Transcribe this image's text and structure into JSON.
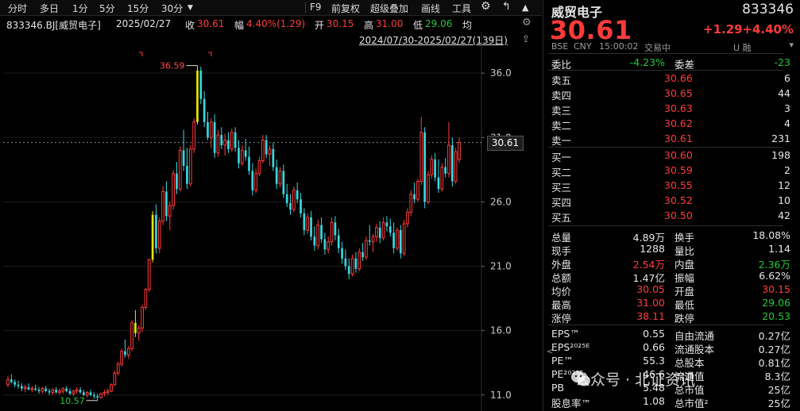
{
  "toolbar": {
    "periods": [
      "分时",
      "多日",
      "1分",
      "5分",
      "15分",
      "30分"
    ],
    "f9": "F9",
    "adjust": "前复权",
    "overlay": "超级叠加",
    "draw": "画线",
    "tools": "工具",
    "icons": [
      "gear-icon",
      "back-icon",
      "up-icon"
    ]
  },
  "infobar": {
    "code_name": "833346.BJ[威贸电子]",
    "date": "2025/02/27",
    "close_label": "收",
    "close": "30.61",
    "change_label": "幅",
    "change": "4.40%(1.29)",
    "open_label": "开",
    "open": "30.15",
    "high_label": "高",
    "high": "31.00",
    "low_label": "低",
    "low": "29.06",
    "avg_label": "均"
  },
  "range_text": "2024/07/30-2025/02/27(139日)",
  "chart_data": {
    "type": "candlestick",
    "ylim": [
      10.0,
      38.6
    ],
    "y_ticks": [
      "36.0",
      "31.0",
      "26.0",
      "21.0",
      "16.0",
      "11.0"
    ],
    "y_tick_values": [
      36.0,
      31.0,
      26.0,
      21.0,
      16.0,
      11.0
    ],
    "last_price": "30.61",
    "high_marker": "36.59",
    "low_marker": "10.57",
    "candles": [
      [
        11.8,
        12.5,
        11.6,
        12.2
      ],
      [
        12.2,
        12.6,
        11.9,
        12.0
      ],
      [
        12.0,
        12.2,
        11.6,
        11.8
      ],
      [
        11.8,
        12.1,
        11.5,
        11.7
      ],
      [
        11.7,
        11.9,
        11.3,
        11.5
      ],
      [
        11.5,
        11.8,
        11.2,
        11.6
      ],
      [
        11.6,
        11.9,
        11.4,
        11.4
      ],
      [
        11.4,
        11.7,
        11.2,
        11.5
      ],
      [
        11.5,
        11.8,
        11.3,
        11.4
      ],
      [
        11.4,
        11.6,
        11.1,
        11.3
      ],
      [
        11.3,
        11.6,
        11.1,
        11.5
      ],
      [
        11.5,
        11.7,
        11.2,
        11.3
      ],
      [
        11.3,
        11.5,
        11.0,
        11.2
      ],
      [
        11.2,
        11.5,
        11.0,
        11.4
      ],
      [
        11.4,
        11.6,
        11.1,
        11.2
      ],
      [
        11.2,
        11.5,
        11.0,
        11.3
      ],
      [
        11.3,
        11.6,
        11.1,
        11.5
      ],
      [
        11.5,
        11.7,
        11.2,
        11.3
      ],
      [
        11.3,
        11.5,
        11.0,
        11.1
      ],
      [
        11.1,
        11.4,
        10.9,
        11.3
      ],
      [
        11.3,
        11.6,
        11.1,
        11.4
      ],
      [
        11.4,
        11.6,
        11.1,
        11.2
      ],
      [
        11.2,
        11.4,
        10.9,
        11.0
      ],
      [
        11.0,
        11.3,
        10.8,
        11.2
      ],
      [
        11.2,
        11.4,
        10.9,
        11.0
      ],
      [
        11.0,
        11.2,
        10.7,
        10.9
      ],
      [
        10.9,
        11.1,
        10.57,
        10.8
      ],
      [
        10.8,
        11.2,
        10.7,
        11.1
      ],
      [
        11.1,
        11.4,
        10.9,
        11.2
      ],
      [
        11.2,
        11.5,
        11.0,
        11.3
      ],
      [
        11.3,
        11.9,
        11.2,
        11.8
      ],
      [
        11.8,
        12.9,
        11.7,
        12.7
      ],
      [
        12.7,
        13.6,
        12.5,
        13.4
      ],
      [
        13.4,
        14.6,
        13.2,
        14.4
      ],
      [
        14.4,
        15.3,
        13.9,
        14.1
      ],
      [
        14.1,
        14.8,
        13.8,
        14.6
      ],
      [
        14.6,
        16.8,
        14.4,
        16.6
      ],
      [
        16.6,
        17.6,
        15.5,
        15.8
      ],
      [
        15.8,
        16.4,
        15.2,
        16.2
      ],
      [
        16.2,
        18.0,
        15.9,
        17.8
      ],
      [
        17.8,
        19.3,
        17.6,
        19.2
      ],
      [
        19.2,
        21.6,
        19.0,
        21.5
      ],
      [
        21.5,
        25.3,
        21.3,
        25.0
      ],
      [
        25.0,
        25.8,
        22.0,
        22.4
      ],
      [
        22.4,
        24.8,
        22.0,
        24.5
      ],
      [
        24.5,
        27.2,
        24.2,
        26.8
      ],
      [
        26.8,
        27.6,
        24.5,
        24.9
      ],
      [
        24.9,
        26.0,
        23.8,
        25.7
      ],
      [
        25.7,
        28.5,
        25.4,
        28.2
      ],
      [
        28.2,
        29.1,
        26.6,
        27.0
      ],
      [
        27.0,
        30.3,
        26.8,
        30.0
      ],
      [
        30.0,
        31.6,
        28.4,
        28.8
      ],
      [
        28.8,
        30.2,
        27.0,
        27.4
      ],
      [
        27.4,
        30.4,
        27.2,
        30.1
      ],
      [
        30.1,
        32.5,
        29.8,
        32.2
      ],
      [
        32.2,
        36.59,
        32.0,
        36.2
      ],
      [
        36.2,
        36.5,
        33.6,
        34.0
      ],
      [
        34.0,
        34.6,
        31.8,
        32.2
      ],
      [
        32.2,
        33.0,
        30.8,
        31.0
      ],
      [
        31.0,
        32.5,
        30.2,
        32.2
      ],
      [
        32.2,
        32.8,
        29.4,
        29.8
      ],
      [
        29.8,
        31.6,
        29.5,
        31.2
      ],
      [
        31.2,
        31.8,
        30.1,
        30.4
      ],
      [
        30.4,
        31.3,
        29.6,
        30.8
      ],
      [
        30.8,
        31.4,
        29.8,
        30.1
      ],
      [
        30.1,
        31.7,
        29.9,
        31.4
      ],
      [
        31.4,
        31.8,
        29.9,
        30.2
      ],
      [
        30.2,
        30.8,
        28.6,
        29.0
      ],
      [
        29.0,
        30.4,
        28.8,
        30.0
      ],
      [
        30.0,
        30.9,
        29.2,
        29.5
      ],
      [
        29.5,
        30.3,
        28.1,
        28.4
      ],
      [
        28.4,
        29.0,
        26.5,
        26.9
      ],
      [
        26.9,
        28.6,
        26.7,
        28.2
      ],
      [
        28.2,
        29.5,
        28.0,
        29.2
      ],
      [
        29.2,
        31.2,
        29.0,
        30.8
      ],
      [
        30.8,
        31.2,
        29.4,
        29.7
      ],
      [
        29.7,
        30.4,
        28.8,
        30.1
      ],
      [
        30.1,
        30.6,
        28.4,
        28.7
      ],
      [
        28.7,
        29.3,
        27.0,
        27.4
      ],
      [
        27.4,
        28.7,
        27.1,
        28.4
      ],
      [
        28.4,
        28.9,
        26.3,
        26.6
      ],
      [
        26.6,
        27.4,
        25.6,
        25.9
      ],
      [
        25.9,
        26.6,
        25.0,
        25.4
      ],
      [
        25.4,
        27.2,
        25.2,
        26.9
      ],
      [
        26.9,
        27.5,
        25.9,
        26.2
      ],
      [
        26.2,
        26.7,
        24.8,
        25.1
      ],
      [
        25.1,
        25.5,
        23.4,
        23.8
      ],
      [
        23.8,
        25.1,
        23.5,
        24.8
      ],
      [
        24.8,
        25.3,
        23.0,
        23.3
      ],
      [
        23.3,
        24.1,
        22.2,
        22.6
      ],
      [
        22.6,
        24.6,
        22.3,
        24.2
      ],
      [
        24.2,
        24.8,
        22.8,
        23.1
      ],
      [
        23.1,
        23.6,
        21.9,
        22.3
      ],
      [
        22.3,
        23.3,
        22.0,
        22.9
      ],
      [
        22.9,
        24.8,
        22.6,
        24.4
      ],
      [
        24.4,
        24.9,
        23.0,
        23.4
      ],
      [
        23.4,
        23.9,
        22.0,
        22.4
      ],
      [
        22.4,
        22.9,
        21.2,
        21.6
      ],
      [
        21.6,
        22.3,
        20.7,
        21.0
      ],
      [
        21.0,
        21.6,
        20.0,
        20.4
      ],
      [
        20.4,
        21.9,
        20.2,
        21.6
      ],
      [
        21.6,
        22.1,
        20.5,
        20.8
      ],
      [
        20.8,
        22.4,
        20.6,
        22.1
      ],
      [
        22.1,
        22.8,
        21.4,
        21.7
      ],
      [
        21.7,
        23.3,
        21.5,
        23.0
      ],
      [
        23.0,
        24.2,
        22.6,
        22.9
      ],
      [
        22.9,
        23.5,
        22.1,
        23.3
      ],
      [
        23.3,
        24.3,
        22.9,
        24.0
      ],
      [
        24.0,
        24.5,
        22.8,
        23.2
      ],
      [
        23.2,
        24.8,
        23.0,
        24.4
      ],
      [
        24.4,
        24.9,
        23.7,
        24.1
      ],
      [
        24.1,
        24.7,
        23.3,
        23.6
      ],
      [
        23.6,
        24.4,
        22.0,
        22.4
      ],
      [
        22.4,
        24.0,
        22.2,
        23.8
      ],
      [
        23.8,
        24.2,
        21.6,
        22.0
      ],
      [
        22.0,
        24.6,
        21.8,
        24.3
      ],
      [
        24.3,
        25.5,
        24.0,
        25.2
      ],
      [
        25.2,
        26.9,
        24.9,
        26.6
      ],
      [
        26.6,
        27.5,
        25.9,
        26.2
      ],
      [
        26.2,
        27.8,
        26.0,
        27.6
      ],
      [
        27.6,
        32.6,
        27.3,
        31.4
      ],
      [
        31.4,
        31.8,
        25.5,
        26.0
      ],
      [
        26.0,
        28.4,
        25.8,
        28.1
      ],
      [
        28.1,
        29.6,
        27.8,
        29.3
      ],
      [
        29.3,
        29.8,
        27.6,
        27.9
      ],
      [
        27.9,
        29.3,
        26.7,
        27.0
      ],
      [
        27.0,
        29.0,
        26.8,
        28.7
      ],
      [
        28.7,
        29.4,
        27.9,
        28.2
      ],
      [
        28.2,
        32.2,
        27.9,
        30.4
      ],
      [
        30.4,
        31.0,
        27.2,
        27.6
      ],
      [
        27.6,
        30.2,
        27.4,
        29.9
      ],
      [
        29.3,
        31.0,
        29.06,
        30.61
      ]
    ],
    "limit_up_indices": [
      37,
      42,
      55
    ]
  },
  "quote": {
    "name": "威贸电子",
    "code": "833346",
    "price": "30.61",
    "change": "+1.29",
    "change_pct": "+4.40%",
    "market": "BSE",
    "currency": "CNY",
    "time": "15:00:02",
    "status": "交易中",
    "flags": "U 融"
  },
  "bid_ask_ratio": {
    "ratio_label": "委比",
    "ratio": "-4.23%",
    "diff_label": "委差",
    "diff": "-23"
  },
  "asks": [
    {
      "label": "卖五",
      "price": "30.66",
      "vol": "6"
    },
    {
      "label": "卖四",
      "price": "30.65",
      "vol": "44"
    },
    {
      "label": "卖三",
      "price": "30.63",
      "vol": "3"
    },
    {
      "label": "卖二",
      "price": "30.62",
      "vol": "4"
    },
    {
      "label": "卖一",
      "price": "30.61",
      "vol": "231"
    }
  ],
  "bids": [
    {
      "label": "买一",
      "price": "30.60",
      "vol": "198"
    },
    {
      "label": "买二",
      "price": "30.59",
      "vol": "2"
    },
    {
      "label": "买三",
      "price": "30.55",
      "vol": "12"
    },
    {
      "label": "买四",
      "price": "30.52",
      "vol": "10"
    },
    {
      "label": "买五",
      "price": "30.50",
      "vol": "42"
    }
  ],
  "stats": [
    {
      "l1": "总量",
      "v1": "4.89万",
      "c1": "white",
      "l2": "换手",
      "v2": "18.08%",
      "c2": "white"
    },
    {
      "l1": "现手",
      "v1": "1288",
      "c1": "white",
      "l2": "量比",
      "v2": "1.14",
      "c2": "white"
    },
    {
      "l1": "外盘",
      "v1": "2.54万",
      "c1": "red",
      "l2": "内盘",
      "v2": "2.36万",
      "c2": "green"
    },
    {
      "l1": "总额",
      "v1": "1.47亿",
      "c1": "white",
      "l2": "振幅",
      "v2": "6.62%",
      "c2": "white"
    },
    {
      "l1": "均价",
      "v1": "30.05",
      "c1": "red",
      "l2": "开盘",
      "v2": "30.15",
      "c2": "red"
    },
    {
      "l1": "最高",
      "v1": "31.00",
      "c1": "red",
      "l2": "最低",
      "v2": "29.06",
      "c2": "green"
    },
    {
      "l1": "涨停",
      "v1": "38.11",
      "c1": "red",
      "l2": "跌停",
      "v2": "20.53",
      "c2": "green"
    }
  ],
  "fundamentals": [
    {
      "l1": "EPS™",
      "v1": "0.55",
      "l2": "自由流通",
      "v2": "0.27亿"
    },
    {
      "l1": "EPS²⁰²⁵ᴱ",
      "v1": "0.66",
      "l2": "流通股本",
      "v2": "0.27亿"
    },
    {
      "l1": "PE™",
      "v1": "55.3",
      "l2": "总股本",
      "v2": "0.81亿"
    },
    {
      "l1": "PE²⁰²⁵ᴱ",
      "v1": "46.6",
      "l2": "流通值",
      "v2": "8.3亿"
    },
    {
      "l1": "PB",
      "v1": "5.48",
      "l2": "总市值",
      "v2": "25亿"
    },
    {
      "l1": "股息率™",
      "v1": "1.08",
      "l2": "总市值²",
      "v2": "25亿"
    }
  ],
  "watermark": "公众号 · 北证资讯",
  "colors": {
    "up": "#ff3b3b",
    "down": "#20c83a",
    "limit": "#e6e600",
    "down_candle": "#38d8e0"
  }
}
